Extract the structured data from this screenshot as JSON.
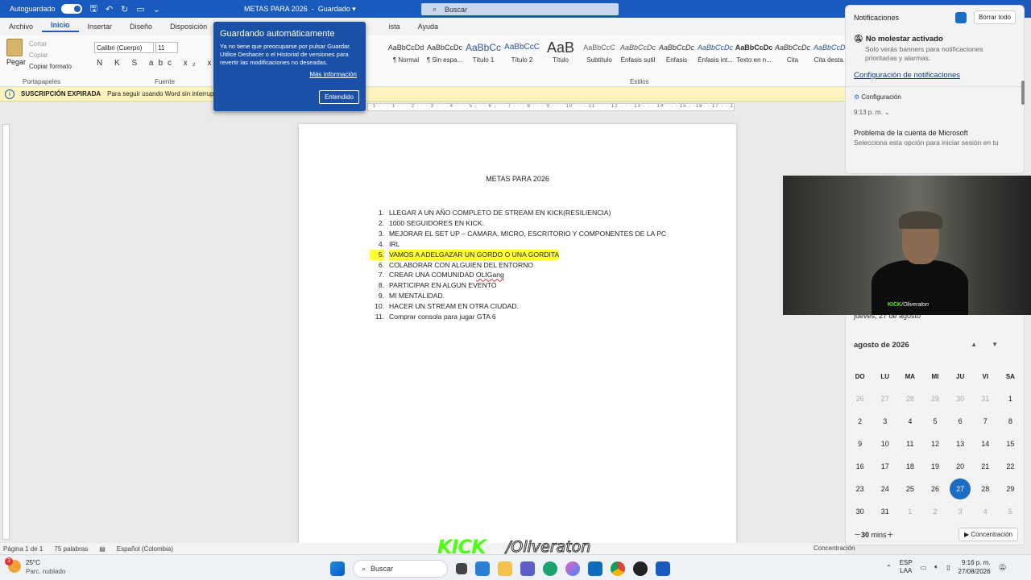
{
  "titlebar": {
    "autosave": "Autoguardado",
    "doc_title": "METAS PARA 2026",
    "save_state": "Guardado",
    "search": "Buscar"
  },
  "ribbon_tabs": [
    "Archivo",
    "Inicio",
    "Insertar",
    "Diseño",
    "Disposición",
    "Re",
    "ista",
    "Ayuda"
  ],
  "clipboard": {
    "paste": "Pegar",
    "cut": "Cortar",
    "copy": "Copiar",
    "format": "Copiar formato",
    "group": "Portapapeles"
  },
  "font": {
    "name": "Calibri (Cuerpo)",
    "size": "11",
    "group": "Fuente",
    "format_row": "N K S abc x₂ x²"
  },
  "styles": {
    "group": "Estilos",
    "items": [
      {
        "preview": "AaBbCcDd",
        "name": "¶ Normal"
      },
      {
        "preview": "AaBbCcDc",
        "name": "¶ Sin espa..."
      },
      {
        "preview": "AaBbCc",
        "name": "Título 1"
      },
      {
        "preview": "AaBbCcC",
        "name": "Título 2"
      },
      {
        "preview": "AaB",
        "name": "Título"
      },
      {
        "preview": "AaBbCcC",
        "name": "Subtítulo"
      },
      {
        "preview": "AaBbCcDc",
        "name": "Énfasis sutil"
      },
      {
        "preview": "AaBbCcDc",
        "name": "Énfasis"
      },
      {
        "preview": "AaBbCcDc",
        "name": "Énfasis int..."
      },
      {
        "preview": "AaBbCcDc",
        "name": "Texto en n..."
      },
      {
        "preview": "AaBbCcDc",
        "name": "Cita"
      },
      {
        "preview": "AaBbCcDc",
        "name": "Cita desta..."
      }
    ]
  },
  "infobar": {
    "title": "SUSCRIPCIÓN EXPIRADA",
    "text": "Para seguir usando Word sin interrupció"
  },
  "popup": {
    "title": "Guardando automáticamente",
    "body": "Ya no tiene que preocuparse por pulsar Guardar. Utilice Deshacer o el Historial de versiones para revertir las modificaciones no deseadas.",
    "link": "Más información",
    "button": "Entendido"
  },
  "ruler": "· 1 · · · 1 · · · 2 · · · 3 · · · 4 · · · 5 · · · 6 · · · 7 · · · 8 · · · 9 · · · 10 · · · 11 · · · 12 · · · 13 · · · 14 · · · 15 · ·16· · 17 · · 18",
  "document": {
    "title": "METAS PARA 2026",
    "items": [
      {
        "n": "1.",
        "text": "LLEGAR A UN AÑO COMPLETO DE STREAM EN KICK(RESILIENCIA)"
      },
      {
        "n": "2.",
        "text": "1000 SEGUIDORES EN KICK."
      },
      {
        "n": "3.",
        "text": "MEJORAR EL SET UP – CAMARA, MICRO, ESCRITORIO Y COMPONENTES DE LA PC"
      },
      {
        "n": "4.",
        "text": "IRL"
      },
      {
        "n": "5.",
        "text": "VAMOS A ADELGAZAR UN GORDO O UNA GORDITA",
        "highlight": true
      },
      {
        "n": "6.",
        "text": "COLABORAR CON ALGUIEN DEL ENTORNO"
      },
      {
        "n": "7.",
        "text": "CREAR UNA COMUNIDAD ",
        "squiggle": "OLIGang"
      },
      {
        "n": "8.",
        "text": "PARTICIPAR EN ALGUN EVENTO"
      },
      {
        "n": "9.",
        "text": "MI MENTALIDAD."
      },
      {
        "n": "10.",
        "text": "HACER UN STREAM EN OTRA CIUDAD."
      },
      {
        "n": "11.",
        "text": "Comprar consola para jugar GTA 6"
      }
    ]
  },
  "statusbar": {
    "page": "Página 1 de 1",
    "words": "75 palabras",
    "lang": "Español (Colombia)",
    "focus": "Concentración"
  },
  "overlay": {
    "kick": "KICK",
    "name": "/Oliveraton",
    "cam_kick": "KICK",
    "cam_name": "/Oliveraton"
  },
  "taskbar": {
    "temp": "25°C",
    "weather": "Parc. nublado",
    "badge": "3",
    "search": "Buscar",
    "lang": "ESP",
    "lang2": "LAA",
    "time": "9:16 p. m.",
    "date": "27/08/2026"
  },
  "notifications": {
    "title": "Notificaciones",
    "clear": "Borrar todo",
    "dnd": "No molestar activado",
    "dnd_sub": "Solo verás banners para notificaciones prioritarias y alarmas.",
    "config_link": "Configuración de notificaciones",
    "config": "Configuración",
    "time": "9:13 p. m.",
    "msg_title": "Problema de la cuenta de Microsoft",
    "msg_body": "Selecciona esta opción para iniciar sesión en tu"
  },
  "calendar": {
    "date": "jueves, 27 de agosto",
    "month": "agosto de 2026",
    "weekdays": [
      "DO",
      "LU",
      "MA",
      "MI",
      "JU",
      "VI",
      "SA"
    ],
    "weeks": [
      [
        "26",
        "27",
        "28",
        "29",
        "30",
        "31",
        "1"
      ],
      [
        "2",
        "3",
        "4",
        "5",
        "6",
        "7",
        "8"
      ],
      [
        "9",
        "10",
        "11",
        "12",
        "13",
        "14",
        "15"
      ],
      [
        "16",
        "17",
        "18",
        "19",
        "20",
        "21",
        "22"
      ],
      [
        "23",
        "24",
        "25",
        "26",
        "27",
        "28",
        "29"
      ],
      [
        "30",
        "31",
        "1",
        "2",
        "3",
        "4",
        "5"
      ]
    ],
    "today": "27",
    "minutes": "30",
    "minutes_unit": "mins",
    "focus": "Concentración"
  }
}
